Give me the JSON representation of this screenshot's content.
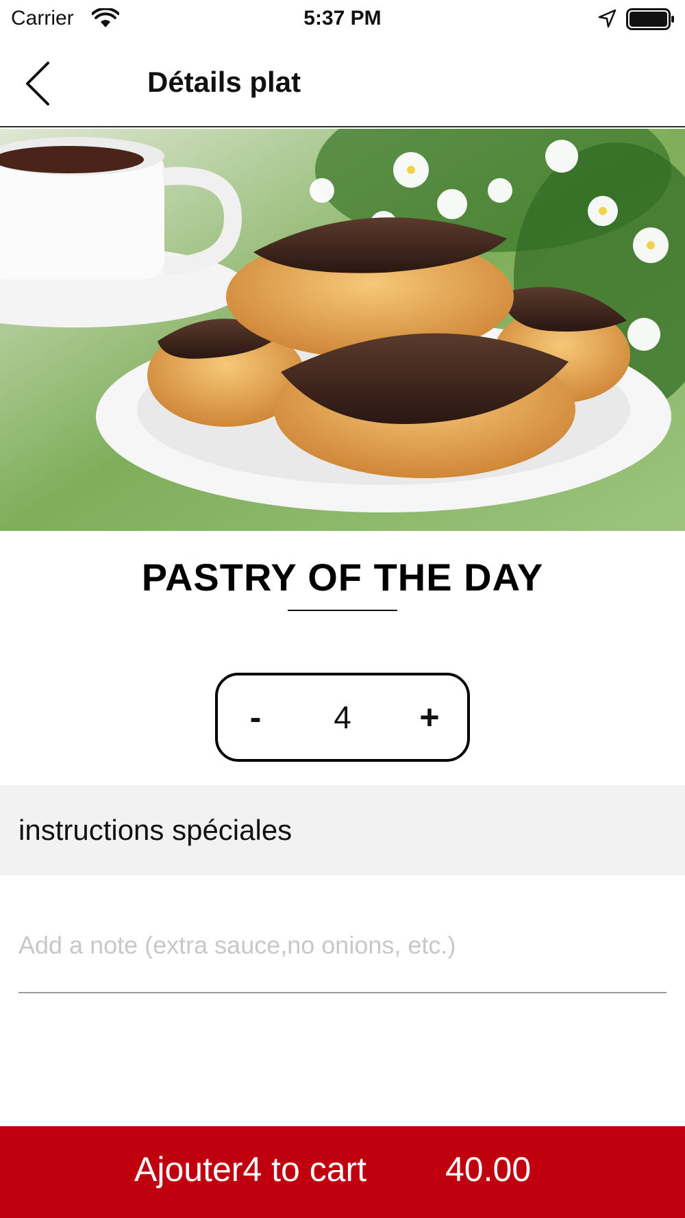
{
  "status_bar": {
    "carrier": "Carrier",
    "time": "5:37 PM"
  },
  "nav": {
    "title": "Détails plat",
    "back_icon": "chevron-left-icon"
  },
  "dish": {
    "name": "PASTRY OF THE DAY",
    "image_subject": "chocolate eclairs on a white plate"
  },
  "quantity": {
    "minus_label": "-",
    "value": "4",
    "plus_label": "+"
  },
  "instructions": {
    "header": "instructions spéciales",
    "note_placeholder": "Add a note (extra sauce,no onions, etc.)",
    "note_value": ""
  },
  "cart": {
    "button_label": "Ajouter4 to cart",
    "price": "40.00"
  },
  "colors": {
    "accent": "#c0000f",
    "section_bg": "#f2f2f2"
  }
}
